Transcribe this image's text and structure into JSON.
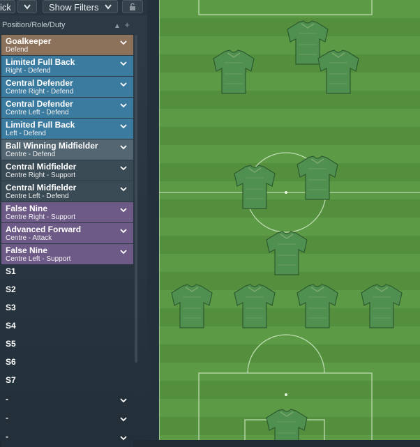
{
  "toolbar": {
    "left_label": "ick",
    "filters_label": "Show Filters"
  },
  "column_header": "Position/Role/Duty",
  "positions": [
    {
      "title": "Goalkeeper",
      "sub": "Defend",
      "group": "gk"
    },
    {
      "title": "Limited Full Back",
      "sub": "Right - Defend",
      "group": "def"
    },
    {
      "title": "Central Defender",
      "sub": "Centre Right - Defend",
      "group": "def"
    },
    {
      "title": "Central Defender",
      "sub": "Centre Left - Defend",
      "group": "def"
    },
    {
      "title": "Limited Full Back",
      "sub": "Left - Defend",
      "group": "def"
    },
    {
      "title": "Ball Winning Midfielder",
      "sub": "Centre - Defend",
      "group": "bwm"
    },
    {
      "title": "Central Midfielder",
      "sub": "Centre Right - Support",
      "group": "mid"
    },
    {
      "title": "Central Midfielder",
      "sub": "Centre Left - Defend",
      "group": "mid"
    },
    {
      "title": "False Nine",
      "sub": "Centre Right - Support",
      "group": "att"
    },
    {
      "title": "Advanced Forward",
      "sub": "Centre - Attack",
      "group": "att"
    },
    {
      "title": "False Nine",
      "sub": "Centre Left - Support",
      "group": "att"
    }
  ],
  "subs": [
    "S1",
    "S2",
    "S3",
    "S4",
    "S5",
    "S6",
    "S7"
  ],
  "reserves": [
    "-",
    "-",
    "-"
  ],
  "colors": {
    "goalkeeper": "#8c715b",
    "defender": "#3c7ba0",
    "midfield_defensive": "#536672",
    "midfielder": "#3a4b56",
    "attacker": "#6e5a87",
    "pitch": "#5c9a45",
    "shirt": "#4f9050"
  },
  "icons": {
    "toolbar_dropdown": "chevron-down-icon",
    "lock": "lock-icon",
    "sort": "sort-icon",
    "add": "plus-icon",
    "row_dropdown": "chevron-down-icon",
    "player": "shirt-icon"
  }
}
